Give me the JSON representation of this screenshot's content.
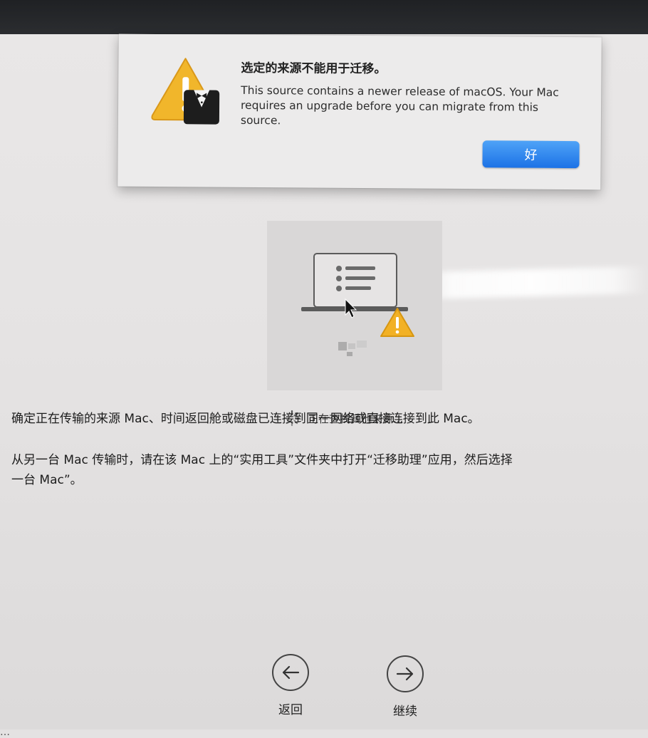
{
  "alert": {
    "title": "选定的来源不能用于迁移。",
    "message": "This source contains a newer release of macOS. Your Mac requires an upgrade before you can migrate from this source.",
    "ok_label": "好"
  },
  "source": {
    "status_text": "正在查找其他来源..."
  },
  "instructions": {
    "line1": "确定正在传输的来源 Mac、时间返回舱或磁盘已连接到同一网络或直接连接到此 Mac。",
    "line2": "从另一台 Mac 传输时，请在该 Mac 上的“实用工具”文件夹中打开“迁移助理”应用，然后选择",
    "line3": "一台 Mac”。"
  },
  "navigation": {
    "back_label": "返回",
    "continue_label": "继续"
  },
  "colors": {
    "accent": "#1c72e6",
    "warning": "#f2b125"
  },
  "icons": {
    "alert": "migration-assistant-warning-icon",
    "source": "laptop-icon",
    "warning_badge": "warning-icon",
    "spinner": "spinner-icon",
    "back": "back-arrow-icon",
    "continue": "forward-arrow-icon"
  }
}
